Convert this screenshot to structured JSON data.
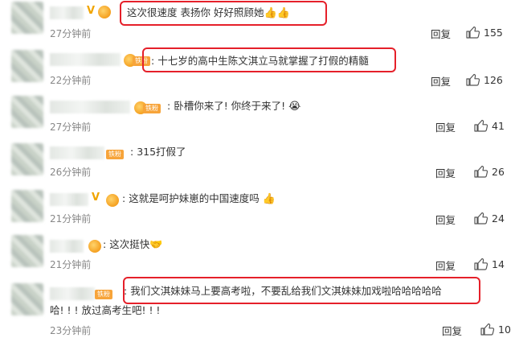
{
  "comments": [
    {
      "text": "这次很速度 表扬你 好好照顾她",
      "emoji": "👍👍",
      "time": "27分钟前",
      "reply": "回复",
      "likes": "155"
    },
    {
      "text": "十七岁的高中生陈文淇立马就掌握了打假的精髓",
      "emoji": "",
      "time": "22分钟前",
      "reply": "回复",
      "likes": "126"
    },
    {
      "text": "卧槽你来了! 你终于来了!",
      "emoji": "😭",
      "time": "27分钟前",
      "reply": "回复",
      "likes": "41"
    },
    {
      "text": "315打假了",
      "emoji": "",
      "time": "26分钟前",
      "reply": "回复",
      "likes": "26"
    },
    {
      "text": "这就是呵护妹崽的中国速度吗",
      "emoji": "👍",
      "time": "21分钟前",
      "reply": "回复",
      "likes": "24"
    },
    {
      "text": "这次挺快",
      "emoji": "🤝",
      "time": "21分钟前",
      "reply": "回复",
      "likes": "14"
    },
    {
      "text": "我们文淇妹妹马上要高考啦，不要乱给我们文淇妹妹加戏啦哈哈哈哈哈",
      "text2": "哈! ! ! 放过高考生吧! ! !",
      "emoji": "",
      "time": "23分钟前",
      "reply": "回复",
      "likes": "10"
    }
  ],
  "badge_tag": "铁粉",
  "icons": {
    "avatar": "avatar-image",
    "thumbs_up": "thumbs-up-icon",
    "verified": "verified-v-badge"
  },
  "colors": {
    "highlight_box": "#e5202a",
    "time": "#888888",
    "badge": "#f7a43a"
  }
}
